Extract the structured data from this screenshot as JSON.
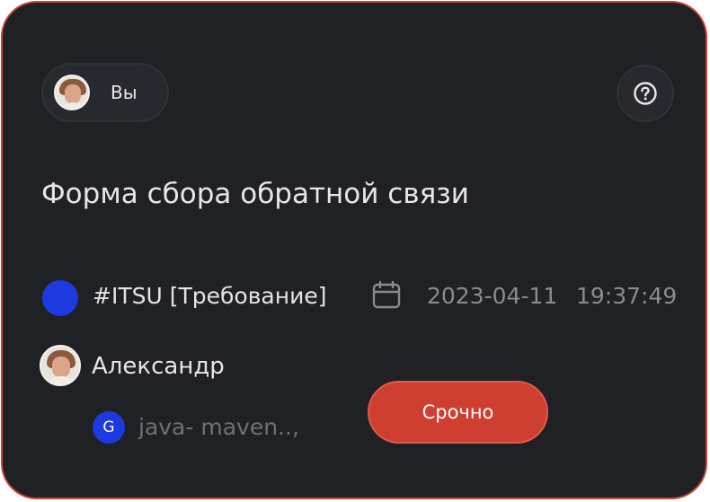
{
  "header": {
    "user_label": "Вы",
    "avatar_icon": "user-avatar",
    "help_icon": "question-circle-icon"
  },
  "form": {
    "title": "Форма сбора обратной связи",
    "tag": "#ITSU [Требование]",
    "tag_color": "#1d3ae0",
    "date": "2023-04-11",
    "time": "19:37:49",
    "calendar_icon": "calendar-icon"
  },
  "assignee": {
    "name": "Александр",
    "project_badge": "G",
    "project": "java- maven..,"
  },
  "priority": {
    "label": "Срочно",
    "color": "#cf3f31"
  },
  "theme": {
    "background": "#1f2125",
    "border": "#c9463a"
  }
}
